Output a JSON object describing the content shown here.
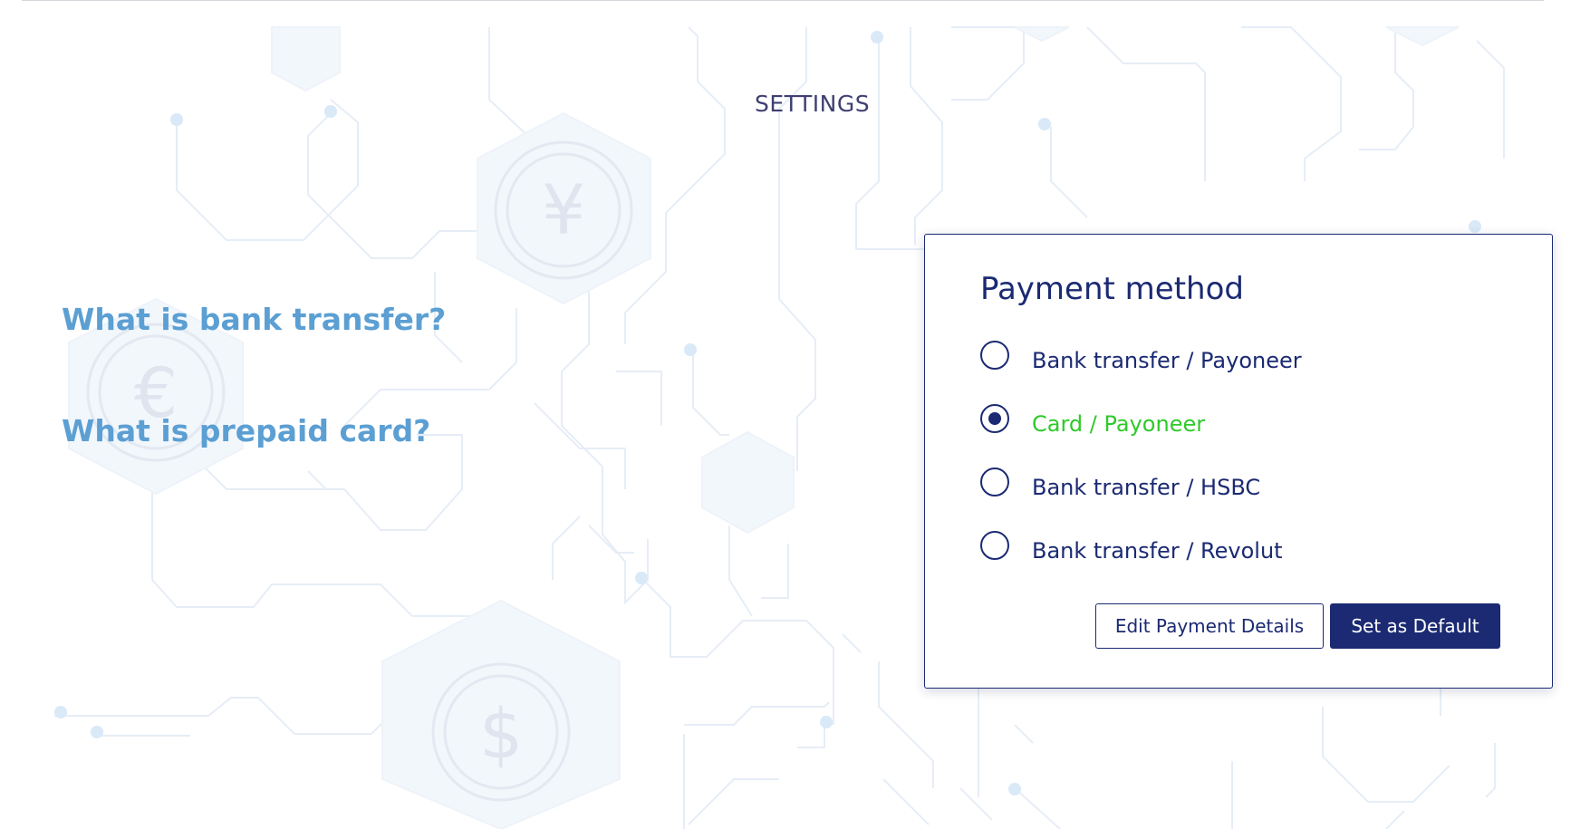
{
  "header": {
    "title": "SETTINGS"
  },
  "faq": {
    "bank_transfer": "What is bank transfer?",
    "prepaid_card": "What is prepaid card?"
  },
  "payment": {
    "title": "Payment method",
    "options": [
      {
        "label": "Bank transfer / Payoneer",
        "selected": false
      },
      {
        "label": "Card / Payoneer",
        "selected": true
      },
      {
        "label": "Bank transfer / HSBC",
        "selected": false
      },
      {
        "label": "Bank transfer / Revolut",
        "selected": false
      }
    ],
    "edit_button": "Edit Payment Details",
    "default_button": "Set as Default"
  },
  "background": {
    "currency_symbols": [
      "¥",
      "€",
      "$"
    ]
  },
  "colors": {
    "primary": "#1b2a72",
    "link": "#5b9fd3",
    "selected_option": "#2fc92a",
    "settings_title": "#3f3f72"
  }
}
